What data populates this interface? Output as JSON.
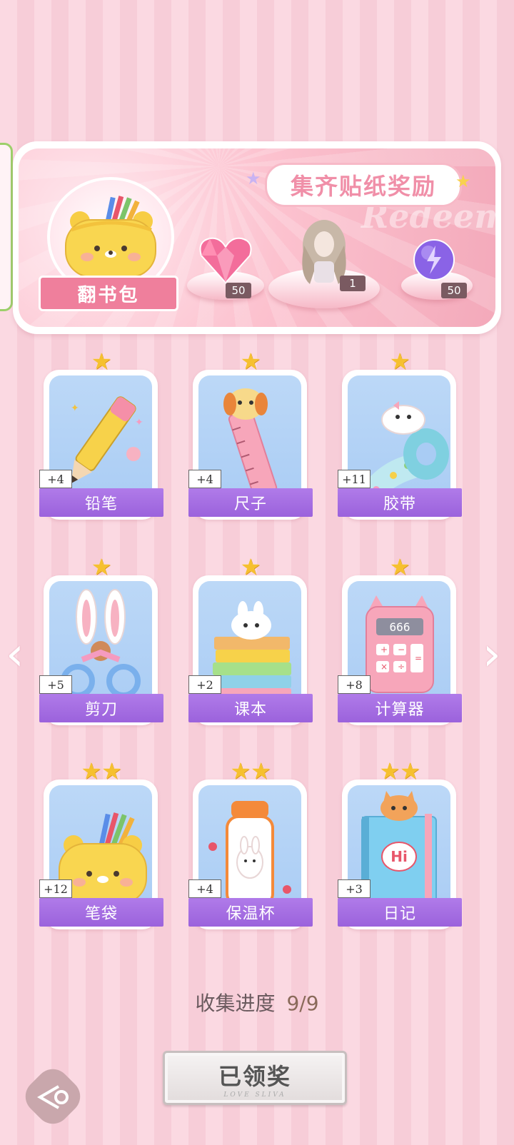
{
  "banner": {
    "title": "集齐贴纸奖励",
    "watermark": "Redeem",
    "bag_label": "翻书包",
    "rewards": [
      {
        "icon": "pink-diamond-heart-icon",
        "count": "50"
      },
      {
        "icon": "character-outfit-icon",
        "count": "1"
      },
      {
        "icon": "purple-energy-orb-icon",
        "count": "50"
      }
    ]
  },
  "stickers": [
    {
      "name": "铅笔",
      "plus": "+4",
      "stars": "★",
      "icon": "pencil-icon"
    },
    {
      "name": "尺子",
      "plus": "+4",
      "stars": "★",
      "icon": "ruler-icon"
    },
    {
      "name": "胶带",
      "plus": "+11",
      "stars": "★",
      "icon": "tape-icon"
    },
    {
      "name": "剪刀",
      "plus": "+5",
      "stars": "★",
      "icon": "scissors-icon"
    },
    {
      "name": "课本",
      "plus": "+2",
      "stars": "★",
      "icon": "textbook-icon"
    },
    {
      "name": "计算器",
      "plus": "+8",
      "stars": "★",
      "icon": "calculator-icon"
    },
    {
      "name": "笔袋",
      "plus": "+12",
      "stars": "★★",
      "icon": "pencil-case-icon"
    },
    {
      "name": "保温杯",
      "plus": "+4",
      "stars": "★★",
      "icon": "thermos-cup-icon"
    },
    {
      "name": "日记",
      "plus": "+3",
      "stars": "★★",
      "icon": "diary-icon"
    }
  ],
  "calculator_display": "666",
  "diary_text": "Hi",
  "progress": {
    "label": "收集进度",
    "value": "9/9"
  },
  "claim_button": {
    "label": "已领奖",
    "sub": "LOVE SLIVA"
  },
  "nav": {
    "left": "‹",
    "right": "›"
  },
  "colors": {
    "label_purple": "#9b62dc",
    "banner_pink": "#f3a9ba",
    "star_gold": "#f6c02f"
  }
}
